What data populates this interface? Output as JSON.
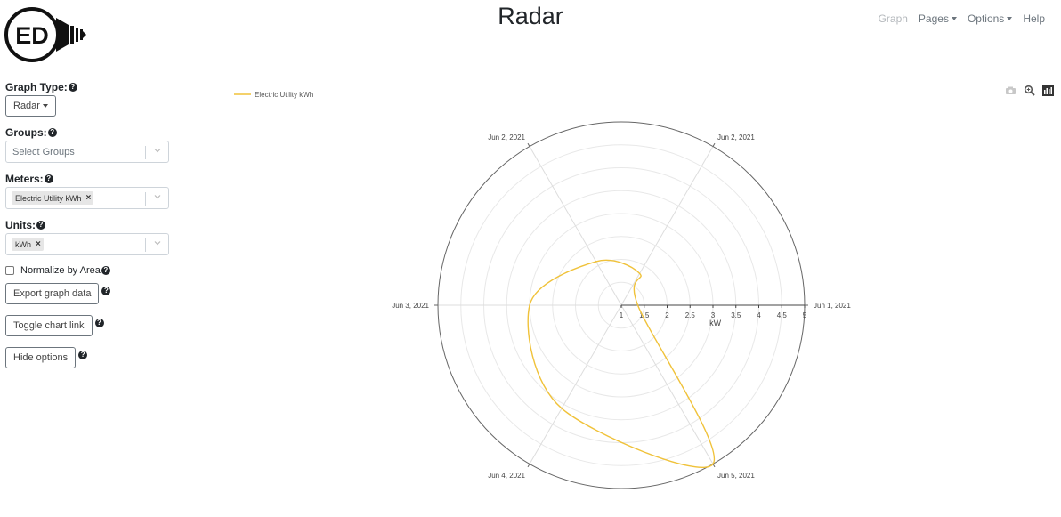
{
  "logo": {
    "text": "ED"
  },
  "header": {
    "title": "Radar"
  },
  "nav": {
    "graph": "Graph",
    "pages": "Pages",
    "options": "Options",
    "help": "Help"
  },
  "sidebar": {
    "graph_type": {
      "label": "Graph Type:",
      "value": "Radar"
    },
    "groups": {
      "label": "Groups:",
      "placeholder": "Select Groups"
    },
    "meters": {
      "label": "Meters:",
      "chips": [
        "Electric Utility kWh"
      ]
    },
    "units": {
      "label": "Units:",
      "chips": [
        "kWh"
      ]
    },
    "normalize": {
      "label": "Normalize by Area",
      "checked": false
    },
    "export_button": "Export graph data",
    "toggle_link_button": "Toggle chart link",
    "hide_options_button": "Hide options",
    "help_glyph": "?",
    "chip_remove": "×"
  },
  "toolbar": {
    "icons": [
      "camera-icon",
      "zoom-icon",
      "chart-logo-icon"
    ]
  },
  "colors": {
    "series": "#f0c23a",
    "axis": "#444444",
    "grid": "#dddddd"
  },
  "chart_data": {
    "type": "radar",
    "legend": {
      "placement": "top-left",
      "entries": [
        "Electric Utility kWh"
      ]
    },
    "angular_labels": [
      "Jun 1, 2021",
      "Jun 2, 2021",
      "Jun 2, 2021",
      "Jun 3, 2021",
      "Jun 4, 2021",
      "Jun 5, 2021"
    ],
    "radial_axis": {
      "title": "kW",
      "range": [
        1,
        5
      ],
      "ticks": [
        "1",
        "1.5",
        "2",
        "2.5",
        "3",
        "3.5",
        "4",
        "4.5",
        "5"
      ],
      "tick_values": [
        1,
        1.5,
        2,
        2.5,
        3,
        3.5,
        4,
        4.5,
        5
      ]
    },
    "series": [
      {
        "name": "Electric Utility kWh",
        "theta_deg": [
          0,
          60,
          120,
          180,
          240,
          300
        ],
        "r": [
          1.36,
          1.8,
          2.1,
          3.0,
          3.6,
          5.0
        ]
      }
    ]
  }
}
